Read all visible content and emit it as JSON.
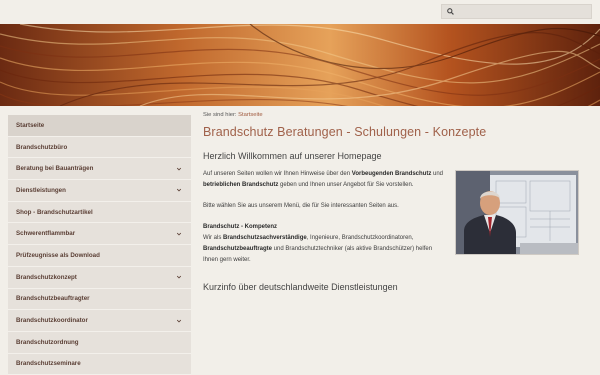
{
  "search": {
    "placeholder": ""
  },
  "breadcrumb": {
    "prefix": "Sie sind hier:",
    "link": "Startseite"
  },
  "sidebar": {
    "items": [
      {
        "label": "Startseite",
        "has_sub": false,
        "active": true
      },
      {
        "label": "Brandschutzbüro",
        "has_sub": false
      },
      {
        "label": "Beratung bei Bauanträgen",
        "has_sub": true
      },
      {
        "label": "Dienstleistungen",
        "has_sub": true
      },
      {
        "label": "Shop - Brandschutzartikel",
        "has_sub": false
      },
      {
        "label": "Schwerentflammbar",
        "has_sub": true
      },
      {
        "label": "Prüfzeugnisse als Download",
        "has_sub": false
      },
      {
        "label": "Brandschutzkonzept",
        "has_sub": true
      },
      {
        "label": "Brandschutzbeauftragter",
        "has_sub": false
      },
      {
        "label": "Brandschutzkoordinator",
        "has_sub": true
      },
      {
        "label": "Brandschutzordnung",
        "has_sub": false
      },
      {
        "label": "Brandschutzseminare",
        "has_sub": false
      }
    ]
  },
  "main": {
    "title": "Brandschutz Beratungen - Schulungen - Konzepte",
    "welcome": "Herzlich Willkommen auf unserer Homepage",
    "p1_a": "Auf unseren Seiten wollen wir Ihnen Hinweise über den ",
    "p1_b": "Vorbeugenden Brandschutz",
    "p1_c": " und ",
    "p1_d": "betrieblichen Brandschutz",
    "p1_e": " geben und Ihnen unser Angebot für Sie vorstellen.",
    "p2": "Bitte wählen Sie aus unserem Menü, die für Sie interessanten Seiten aus.",
    "p3_title": "Brandschutz - Kompetenz",
    "p3_a": "Wir als ",
    "p3_b": "Brandschutzsachverständige",
    "p3_c": ", Ingenieure, Brandschutzkoordinatoren, ",
    "p3_d": "Brandschutzbeauftragte",
    "p3_e": " und Brandschutztechniker (als aktive Brandschützer) helfen Ihnen gern weiter.",
    "subheading": "Kurzinfo über deutschlandweite Dienstleistungen"
  },
  "colors": {
    "accent": "#a0614a",
    "sidebar_bg": "#e6e1db",
    "page_bg": "#f2efe9"
  }
}
